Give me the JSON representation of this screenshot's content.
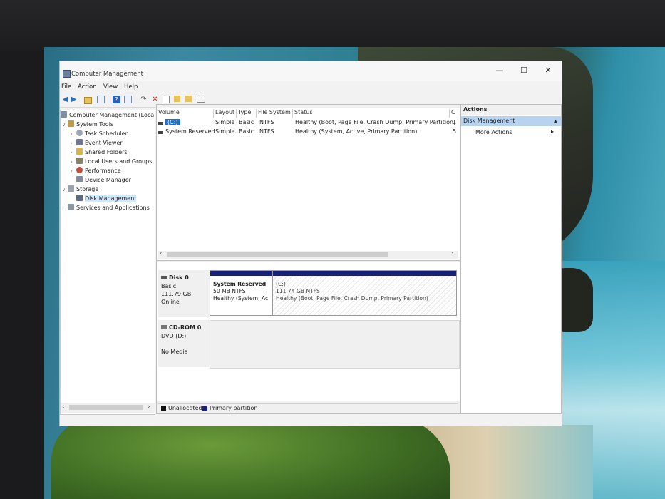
{
  "window": {
    "title": "Computer Management",
    "controls": [
      "—",
      "☐",
      "✕"
    ]
  },
  "menubar": [
    "File",
    "Action",
    "View",
    "Help"
  ],
  "tree": {
    "root": "Computer Management (Local",
    "system_tools": "System Tools",
    "task_scheduler": "Task Scheduler",
    "event_viewer": "Event Viewer",
    "shared_folders": "Shared Folders",
    "local_users": "Local Users and Groups",
    "performance": "Performance",
    "device_manager": "Device Manager",
    "storage": "Storage",
    "disk_management": "Disk Management",
    "services": "Services and Applications"
  },
  "volume_list": {
    "headers": [
      "Volume",
      "Layout",
      "Type",
      "File System",
      "Status",
      "C"
    ],
    "rows": [
      {
        "volume": "(C:)",
        "layout": "Simple",
        "type": "Basic",
        "fs": "NTFS",
        "status": "Healthy (Boot, Page File, Crash Dump, Primary Partition)",
        "cap": "1"
      },
      {
        "volume": "System Reserved",
        "layout": "Simple",
        "type": "Basic",
        "fs": "NTFS",
        "status": "Healthy (System, Active, Primary Partition)",
        "cap": "5"
      }
    ]
  },
  "disks": {
    "disk0": {
      "name": "Disk 0",
      "type": "Basic",
      "size": "111.79 GB",
      "state": "Online"
    },
    "cdrom0": {
      "name": "CD-ROM 0",
      "type": "DVD (D:)",
      "state": "No Media"
    }
  },
  "partitions": {
    "reserved": {
      "name": "System Reserved",
      "size": "50 MB NTFS",
      "status": "Healthy (System, Ac"
    },
    "c": {
      "name": "(C:)",
      "size": "111.74 GB NTFS",
      "status": "Healthy (Boot, Page File, Crash Dump, Primary Partition)"
    }
  },
  "legend": {
    "unallocated": "Unallocated",
    "primary": "Primary partition"
  },
  "actions": {
    "header": "Actions",
    "selected": "Disk Management",
    "more": "More Actions"
  },
  "colors": {
    "primary_partition": "#18207a",
    "unallocated": "#111111",
    "selection": "#b7d3f0",
    "desktop_sea": "#2f8fa8"
  },
  "icons": [
    "back-arrow-icon",
    "forward-arrow-icon",
    "folder-icon",
    "list-icon",
    "help-icon",
    "delete-icon",
    "properties-icon"
  ]
}
